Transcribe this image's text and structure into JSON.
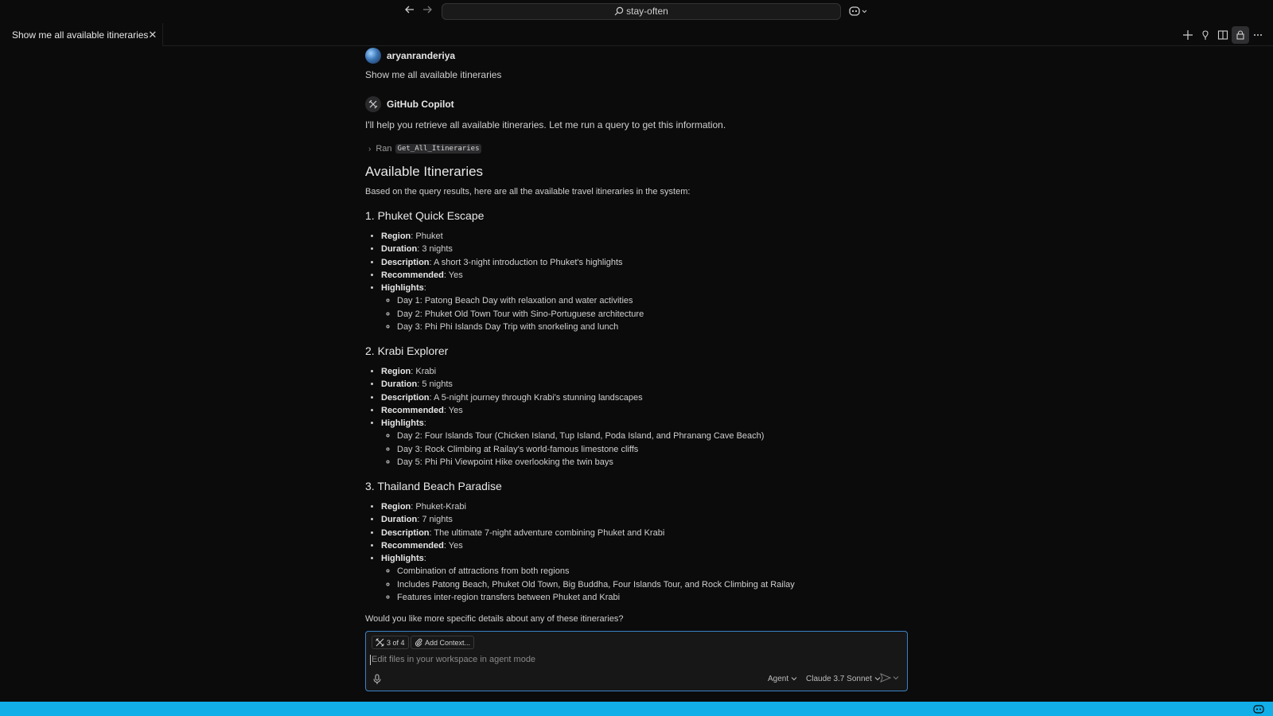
{
  "titlebar": {
    "back_icon": "arrow-left-icon",
    "forward_icon": "arrow-right-icon",
    "search_text": "stay-often",
    "copilot_icon": "copilot-icon"
  },
  "tab": {
    "label": "Show me all available itineraries",
    "icon": "chat-icon",
    "close_icon": "close-icon"
  },
  "tab_actions": [
    "plus-icon",
    "pin-icon",
    "split-editor-icon",
    "lock-icon",
    "more-icon"
  ],
  "chat": {
    "user_name": "aryanranderiya",
    "user_message": "Show me all available itineraries",
    "bot_name": "GitHub Copilot",
    "bot_intro": "I'll help you retrieve all available itineraries. Let me run a query to get this information.",
    "tool_ran_label": "Ran",
    "tool_name": "Get_All_Itineraries",
    "heading": "Available Itineraries",
    "intro": "Based on the query results, here are all the available travel itineraries in the system:",
    "itineraries": [
      {
        "title": "1. Phuket Quick Escape",
        "fields": [
          {
            "label": "Region",
            "value": ": Phuket"
          },
          {
            "label": "Duration",
            "value": ": 3 nights"
          },
          {
            "label": "Description",
            "value": ": A short 3-night introduction to Phuket's highlights"
          },
          {
            "label": "Recommended",
            "value": ": Yes"
          },
          {
            "label": "Highlights",
            "value": ":"
          }
        ],
        "highlights": [
          "Day 1: Patong Beach Day with relaxation and water activities",
          "Day 2: Phuket Old Town Tour with Sino-Portuguese architecture",
          "Day 3: Phi Phi Islands Day Trip with snorkeling and lunch"
        ]
      },
      {
        "title": "2. Krabi Explorer",
        "fields": [
          {
            "label": "Region",
            "value": ": Krabi"
          },
          {
            "label": "Duration",
            "value": ": 5 nights"
          },
          {
            "label": "Description",
            "value": ": A 5-night journey through Krabi's stunning landscapes"
          },
          {
            "label": "Recommended",
            "value": ": Yes"
          },
          {
            "label": "Highlights",
            "value": ":"
          }
        ],
        "highlights": [
          "Day 2: Four Islands Tour (Chicken Island, Tup Island, Poda Island, and Phranang Cave Beach)",
          "Day 3: Rock Climbing at Railay's world-famous limestone cliffs",
          "Day 5: Phi Phi Viewpoint Hike overlooking the twin bays"
        ]
      },
      {
        "title": "3. Thailand Beach Paradise",
        "fields": [
          {
            "label": "Region",
            "value": ": Phuket-Krabi"
          },
          {
            "label": "Duration",
            "value": ": 7 nights"
          },
          {
            "label": "Description",
            "value": ": The ultimate 7-night adventure combining Phuket and Krabi"
          },
          {
            "label": "Recommended",
            "value": ": Yes"
          },
          {
            "label": "Highlights",
            "value": ":"
          }
        ],
        "highlights": [
          "Combination of attractions from both regions",
          "Includes Patong Beach, Phuket Old Town, Big Buddha, Four Islands Tour, and Rock Climbing at Railay",
          "Features inter-region transfers between Phuket and Krabi"
        ]
      }
    ],
    "closing": "Would you like more specific details about any of these itineraries?"
  },
  "input": {
    "tools_chip": "3 of 4",
    "add_context": "Add Context...",
    "placeholder": "Edit files in your workspace in agent mode",
    "mode": "Agent",
    "model": "Claude 3.7 Sonnet"
  },
  "colors": {
    "background": "#0b0b0c",
    "statusbar": "#11aee8",
    "input_border": "#3b82c4"
  }
}
